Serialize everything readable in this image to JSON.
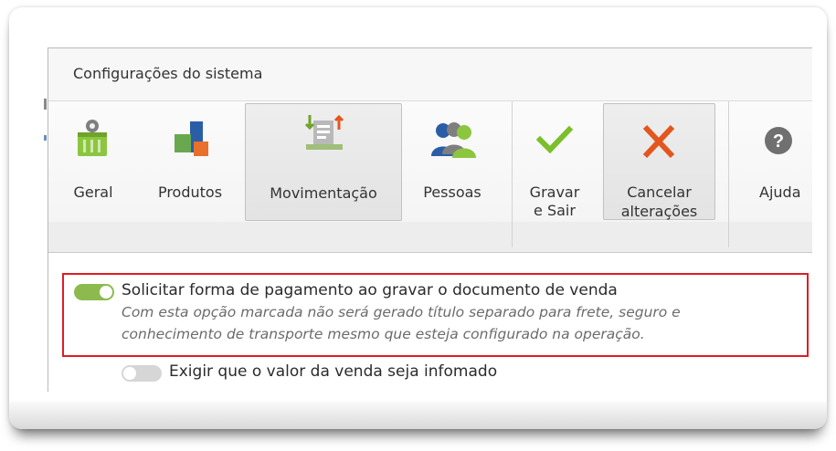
{
  "window": {
    "title": "Configurações do sistema"
  },
  "ribbon": {
    "buttons": [
      {
        "label_line1": "Geral",
        "label_line2": "",
        "icon": "general-settings-icon"
      },
      {
        "label_line1": "Produtos",
        "label_line2": "",
        "icon": "products-icon"
      },
      {
        "label_line1": "Movimentação",
        "label_line2": "",
        "icon": "movement-icon",
        "pressed": true
      },
      {
        "label_line1": "Pessoas",
        "label_line2": "",
        "icon": "people-icon"
      },
      {
        "label_line1": "Gravar",
        "label_line2": "e Sair",
        "icon": "check-icon",
        "accent": "#7bbf2a"
      },
      {
        "label_line1": "Cancelar",
        "label_line2": "alterações",
        "icon": "close-icon",
        "accent": "#e3561e",
        "pressed": true
      },
      {
        "label_line1": "Ajuda",
        "label_line2": "",
        "icon": "help-icon"
      }
    ]
  },
  "options": [
    {
      "label": "Solicitar forma de pagamento ao gravar o documento de venda",
      "description_line1": "Com esta opção marcada não será gerado título separado para frete, seguro e",
      "description_line2": "conhecimento de transporte mesmo que esteja configurado na operação.",
      "enabled": true,
      "highlighted": true
    },
    {
      "label": "Exigir que o valor da venda seja infomado",
      "enabled": false
    }
  ],
  "colors": {
    "toggle_on": "#8dba4e",
    "toggle_off": "#d6d6d6",
    "highlight": "#e01c24"
  }
}
